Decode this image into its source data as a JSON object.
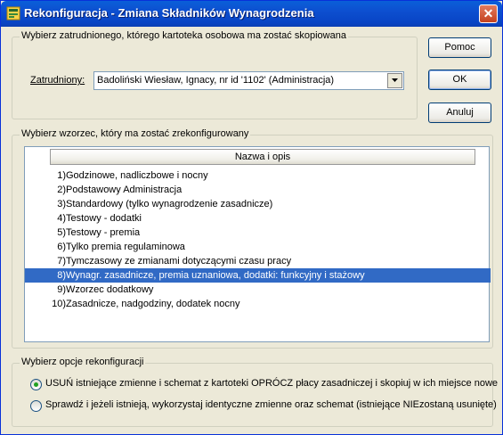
{
  "window": {
    "title": "Rekonfiguracja - Zmiana Składników Wynagrodzenia"
  },
  "employee_group": {
    "title": "Wybierz zatrudnionego, którego kartoteka osobowa ma zostać skopiowana",
    "label": "Zatrudniony:",
    "value": "Badoliński Wiesław, Ignacy, nr id '1102' (Administracja)"
  },
  "buttons": {
    "help": "Pomoc",
    "ok": "OK",
    "cancel": "Anuluj"
  },
  "template_group": {
    "title": "Wybierz wzorzec, który ma zostać zrekonfigurowany",
    "column_header": "Nazwa i opis",
    "items": [
      {
        "num": "1)",
        "label": "Godzinowe, nadliczbowe i nocny"
      },
      {
        "num": "2)",
        "label": "Podstawowy Administracja"
      },
      {
        "num": "3)",
        "label": "Standardowy (tylko wynagrodzenie zasadnicze)"
      },
      {
        "num": "4)",
        "label": "Testowy - dodatki"
      },
      {
        "num": "5)",
        "label": "Testowy - premia"
      },
      {
        "num": "6)",
        "label": "Tylko premia regulaminowa"
      },
      {
        "num": "7)",
        "label": "Tymczasowy ze zmianami dotyczącymi czasu pracy"
      },
      {
        "num": "8)",
        "label": "Wynagr. zasadnicze, premia uznaniowa, dodatki: funkcyjny i stażowy"
      },
      {
        "num": "9)",
        "label": "Wzorzec dodatkowy"
      },
      {
        "num": "10)",
        "label": "Zasadnicze, nadgodziny, dodatek nocny"
      }
    ],
    "selected_index": 7
  },
  "options_group": {
    "title": "Wybierz opcje rekonfiguracji",
    "options": [
      {
        "label": "USUŃ istniejące zmienne i schemat z kartoteki OPRÓCZ płacy zasadniczej i skopiuj w ich miejsce nowe",
        "selected": true
      },
      {
        "label": "Sprawdź i jeżeli istnieją, wykorzystaj identyczne zmienne oraz schemat (istniejące NIEzostaną usunięte)",
        "selected": false
      }
    ]
  },
  "colors": {
    "selection": "#316ac5",
    "titlebar": "#0a5fd8"
  },
  "icons": {
    "window": "app-icon",
    "close": "close-icon",
    "combo": "dropdown-arrow-icon"
  }
}
